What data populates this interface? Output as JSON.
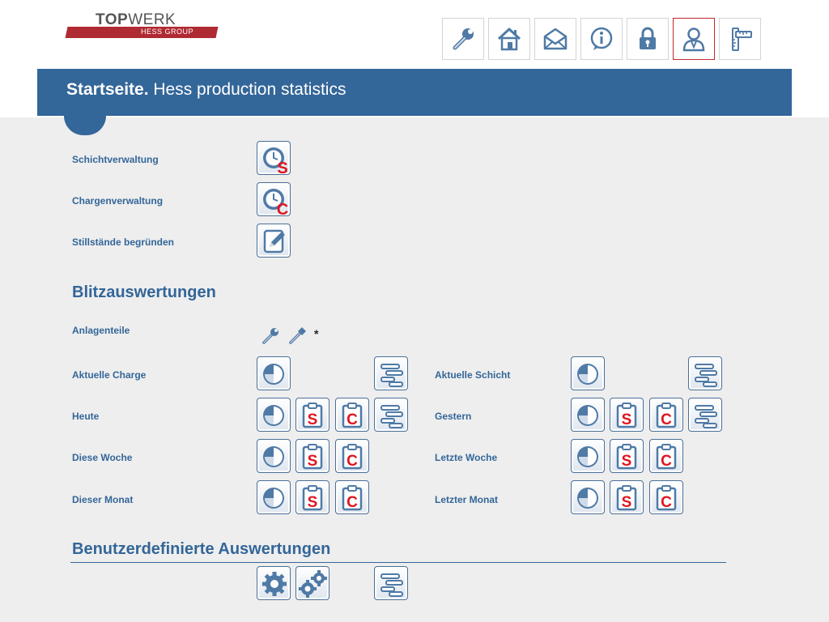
{
  "brand": {
    "name_bold": "TOP",
    "name_thin": "WERK",
    "sub": "HESS GROUP",
    "color": "#b02a33"
  },
  "nav": {
    "items": [
      {
        "name": "wrench-icon"
      },
      {
        "name": "home-icon"
      },
      {
        "name": "mail-icon"
      },
      {
        "name": "info-icon"
      },
      {
        "name": "lock-icon"
      },
      {
        "name": "user-icon",
        "active": true
      },
      {
        "name": "ruler-icon"
      }
    ]
  },
  "header": {
    "title_bold": "Startseite.",
    "title_rest": " Hess production statistics",
    "color": "#336699"
  },
  "admin": {
    "shift_label": "Schichtverwaltung",
    "shift_letter": "S",
    "charge_label": "Chargenverwaltung",
    "charge_letter": "C",
    "downtime_label": "Stillstände begründen"
  },
  "quick": {
    "heading": "Blitzauswertungen",
    "parts_label": "Anlagenteile",
    "parts_asterisk": "*",
    "letters": {
      "shift": "S",
      "charge": "C"
    },
    "rows_left": [
      {
        "label": "Aktuelle Charge"
      },
      {
        "label": "Heute"
      },
      {
        "label": "Diese Woche"
      },
      {
        "label": "Dieser Monat"
      }
    ],
    "rows_right": [
      {
        "label": "Aktuelle Schicht"
      },
      {
        "label": "Gestern"
      },
      {
        "label": "Letzte Woche"
      },
      {
        "label": "Letzter Monat"
      }
    ]
  },
  "custom": {
    "heading": "Benutzerdefinierte Auswertungen"
  }
}
